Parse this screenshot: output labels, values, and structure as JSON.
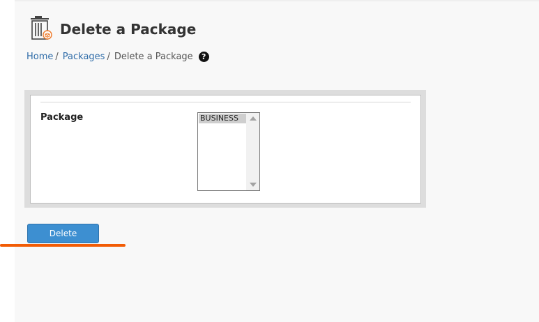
{
  "page": {
    "title": "Delete a Package",
    "icon": "trash-package-icon"
  },
  "breadcrumb": {
    "items": [
      {
        "label": "Home"
      },
      {
        "label": "Packages"
      }
    ],
    "separator": "/",
    "current": "Delete a Package",
    "help_icon": "question-circle-icon",
    "help_glyph": "?"
  },
  "form": {
    "package_label": "Package",
    "options": [
      "BUSINESS"
    ]
  },
  "actions": {
    "delete_label": "Delete"
  },
  "colors": {
    "link": "#2f6ca8",
    "button": "#3d8fd1",
    "annotation": "#f25c05"
  }
}
